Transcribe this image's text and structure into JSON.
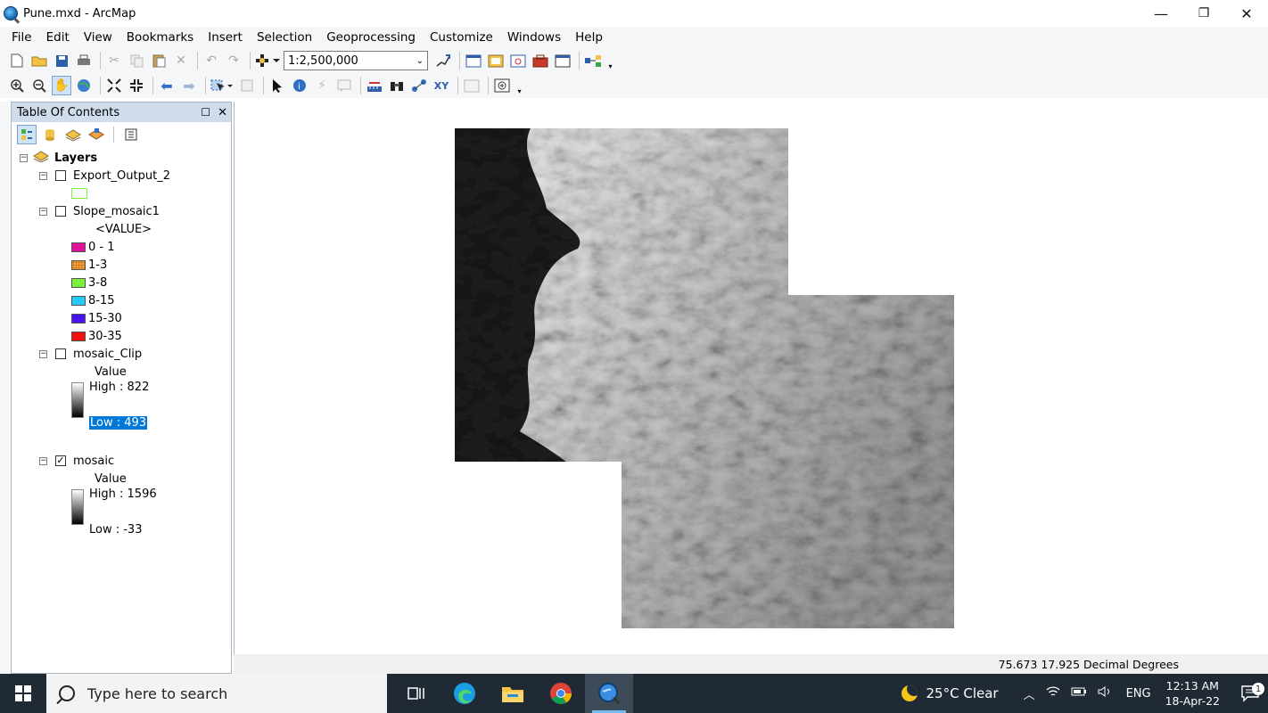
{
  "window": {
    "title": "Pune.mxd - ArcMap",
    "minimize": "—",
    "restore": "❐",
    "close": "✕"
  },
  "menu": [
    "File",
    "Edit",
    "View",
    "Bookmarks",
    "Insert",
    "Selection",
    "Geoprocessing",
    "Customize",
    "Windows",
    "Help"
  ],
  "toolbar": {
    "scale_value": "1:2,500,000"
  },
  "toc": {
    "title": "Table Of Contents",
    "root": "Layers",
    "layers": {
      "export_output": {
        "name": "Export_Output_2",
        "checked": false
      },
      "slope": {
        "name": "Slope_mosaic1",
        "checked": false,
        "field": "<VALUE>",
        "classes": [
          {
            "label": "0 - 1",
            "color": "#e0119c"
          },
          {
            "label": "1-3",
            "color": "#f6a23a"
          },
          {
            "label": "3-8",
            "color": "#7df03c"
          },
          {
            "label": "8-15",
            "color": "#22ccf6"
          },
          {
            "label": "15-30",
            "color": "#4a12ee"
          },
          {
            "label": "30-35",
            "color": "#f01010"
          }
        ]
      },
      "mosaic_clip": {
        "name": "mosaic_Clip",
        "checked": false,
        "field": "Value",
        "high": "High : 822",
        "low": "Low : 493"
      },
      "mosaic": {
        "name": "mosaic",
        "checked": true,
        "check_mark": "✓",
        "field": "Value",
        "high": "High : 1596",
        "low": "Low : -33"
      }
    }
  },
  "status": {
    "coords": "75.673  17.925 Decimal Degrees"
  },
  "taskbar": {
    "search_placeholder": "Type here to search",
    "weather": "25°C  Clear",
    "lang": "ENG",
    "time": "12:13 AM",
    "date": "18-Apr-22",
    "notification_count": "1"
  }
}
